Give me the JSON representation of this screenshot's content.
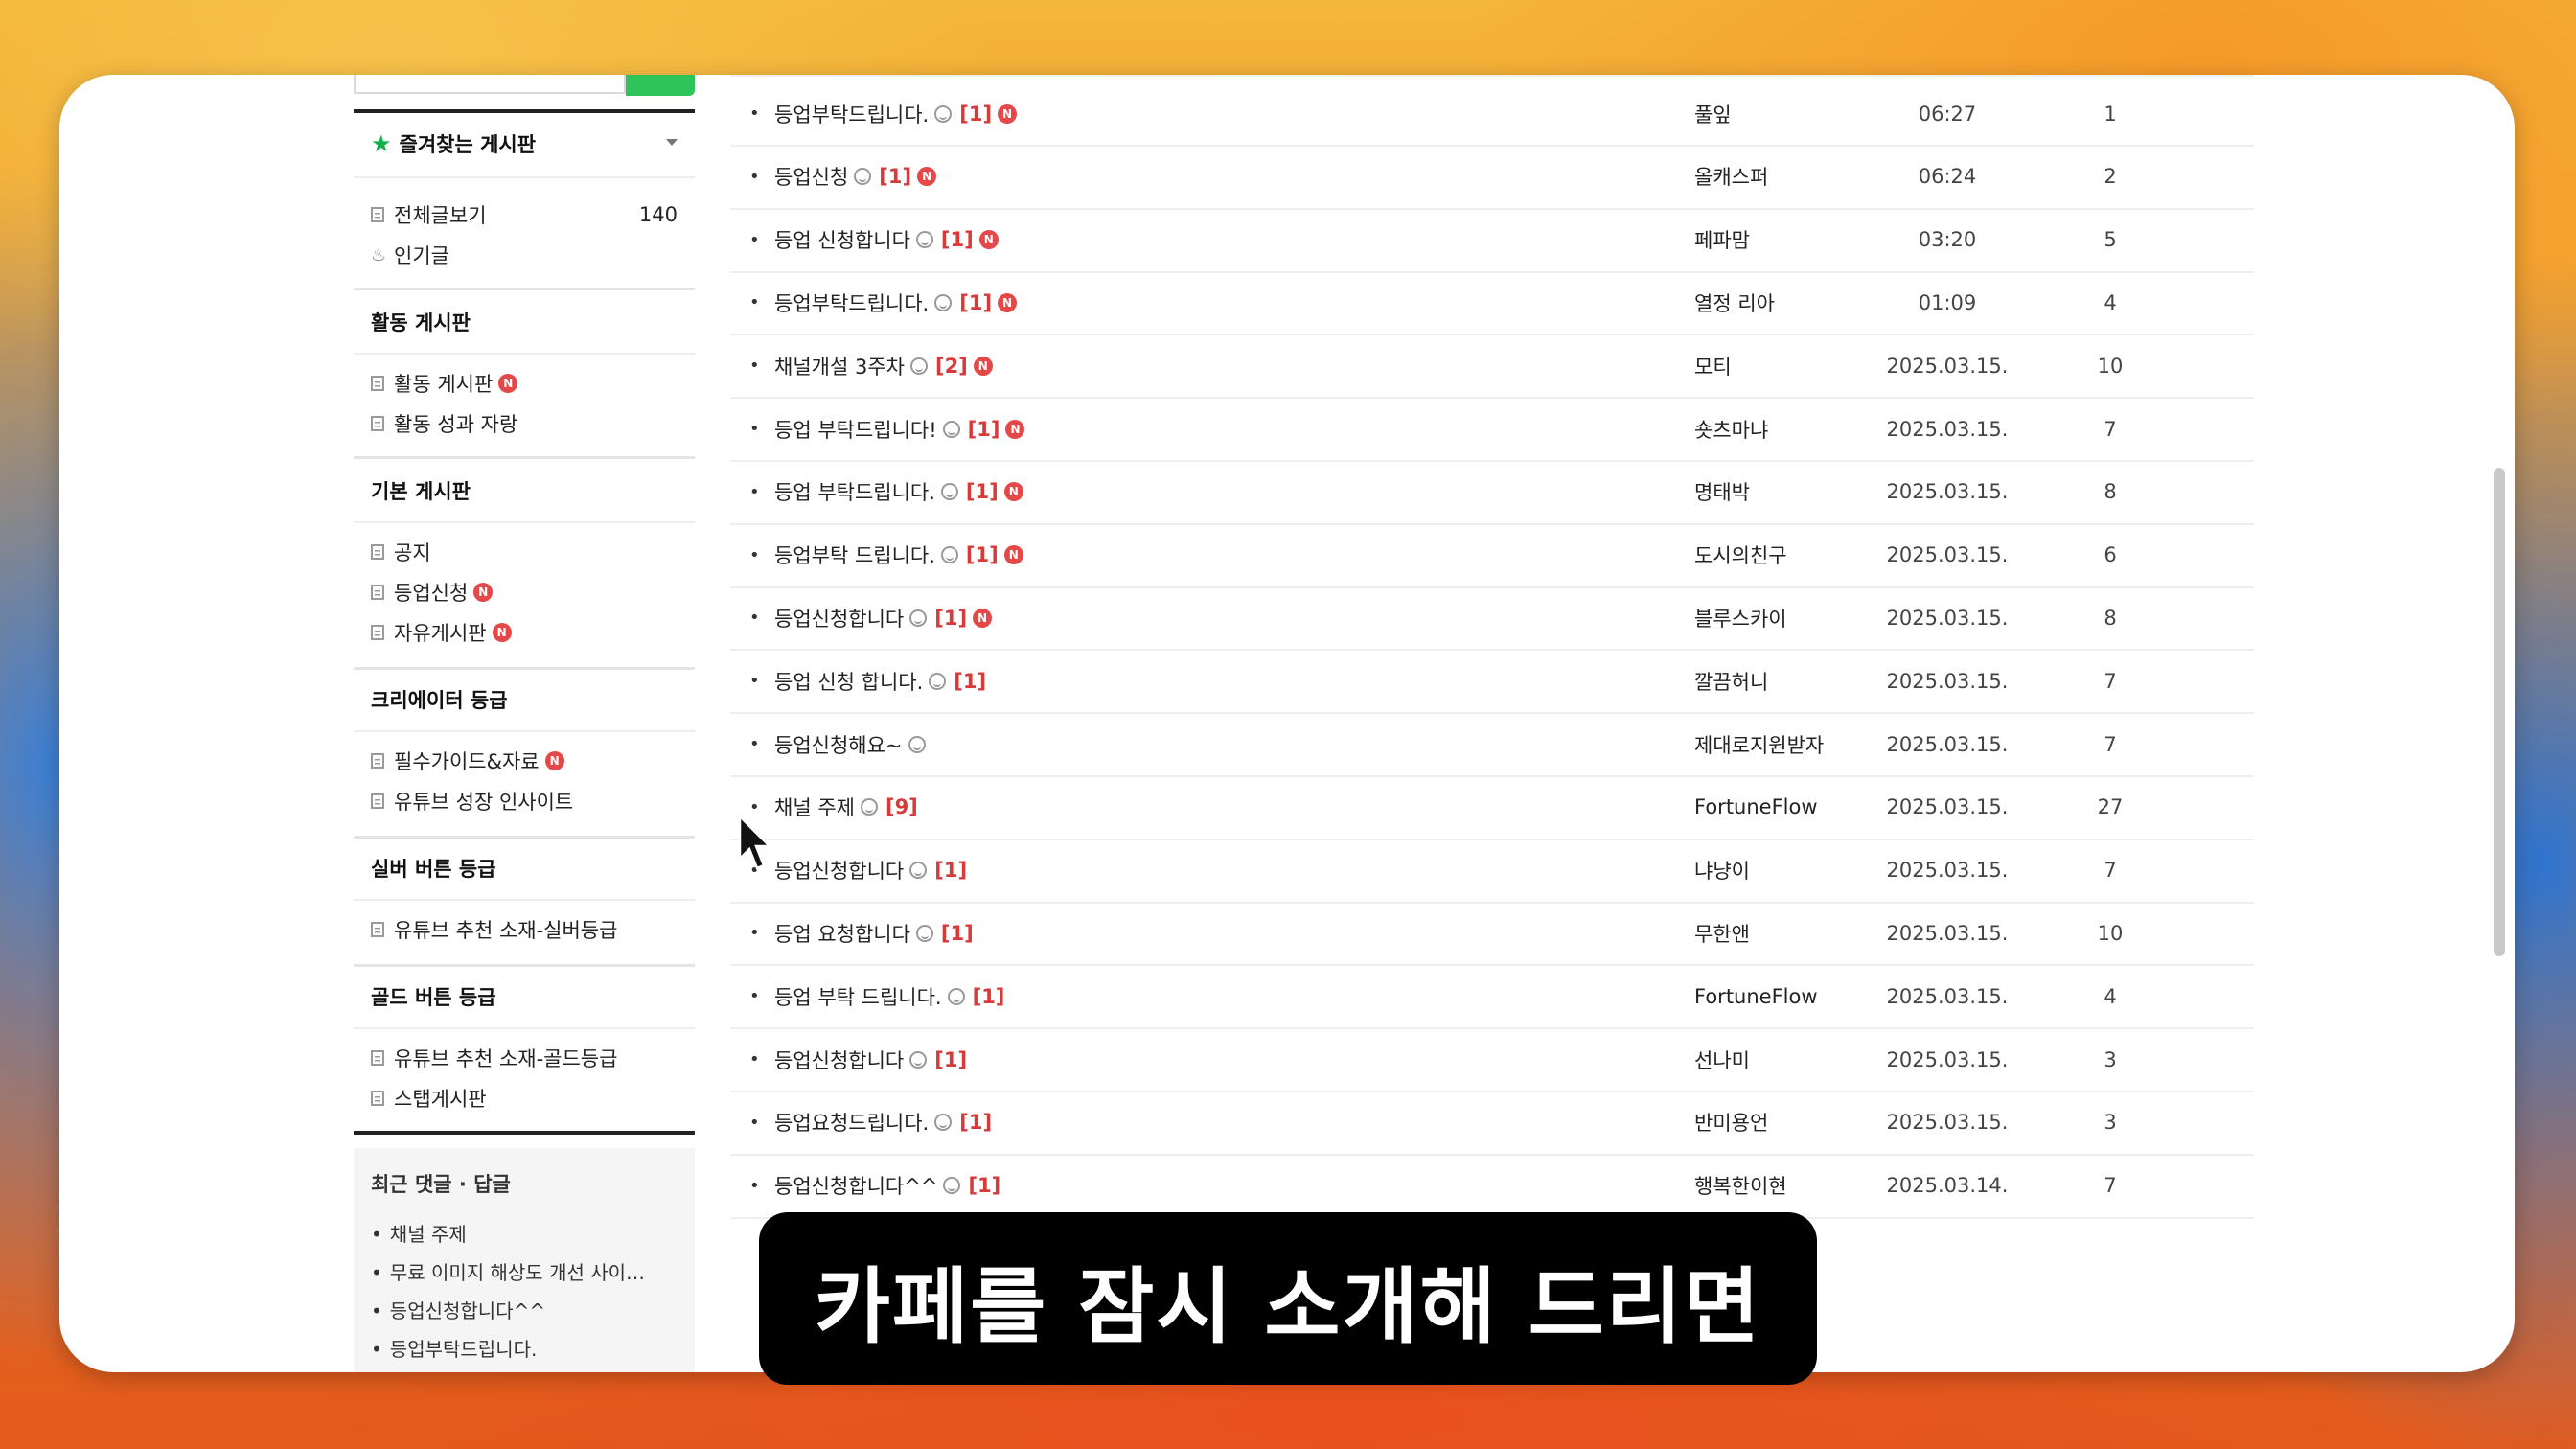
{
  "sidebar": {
    "favorites_label": "즐겨찾는 게시판",
    "all_posts": {
      "label": "전체글보기",
      "count": "140"
    },
    "popular_label": "인기글",
    "sections": [
      {
        "title": "활동 게시판",
        "items": [
          {
            "label": "활동 게시판",
            "new": true
          },
          {
            "label": "활동 성과 자랑",
            "new": false
          }
        ]
      },
      {
        "title": "기본 게시판",
        "items": [
          {
            "label": "공지",
            "new": false
          },
          {
            "label": "등업신청",
            "new": true
          },
          {
            "label": "자유게시판",
            "new": true
          }
        ]
      },
      {
        "title": "크리에이터 등급",
        "items": [
          {
            "label": "필수가이드&자료",
            "new": true
          },
          {
            "label": "유튜브 성장 인사이트",
            "new": false
          }
        ]
      },
      {
        "title": "실버 버튼 등급",
        "items": [
          {
            "label": "유튜브 추천 소재-실버등급",
            "new": false
          }
        ]
      },
      {
        "title": "골드 버튼 등급",
        "items": [
          {
            "label": "유튜브 추천 소재-골드등급",
            "new": false
          },
          {
            "label": "스탭게시판",
            "new": false
          }
        ]
      }
    ],
    "recent": {
      "title": "최근 댓글 · 답글",
      "items": [
        "채널 주제",
        "무료 이미지 해상도 개선 사이…",
        "등업신청합니다^^",
        "등업부탁드립니다."
      ]
    },
    "badge_new": "N"
  },
  "posts": [
    {
      "title": "등업부탁드립니다.",
      "comments": "[1]",
      "new": true,
      "author": "풀잎",
      "date": "06:27",
      "views": "1"
    },
    {
      "title": "등업신청",
      "comments": "[1]",
      "new": true,
      "author": "올캐스퍼",
      "date": "06:24",
      "views": "2"
    },
    {
      "title": "등업 신청합니다",
      "comments": "[1]",
      "new": true,
      "author": "페파맘",
      "date": "03:20",
      "views": "5"
    },
    {
      "title": "등업부탁드립니다.",
      "comments": "[1]",
      "new": true,
      "author": "열정 리아",
      "date": "01:09",
      "views": "4"
    },
    {
      "title": "채널개설 3주차",
      "comments": "[2]",
      "new": true,
      "author": "모티",
      "date": "2025.03.15.",
      "views": "10"
    },
    {
      "title": "등업 부탁드립니다!",
      "comments": "[1]",
      "new": true,
      "author": "숏츠마냐",
      "date": "2025.03.15.",
      "views": "7"
    },
    {
      "title": "등업 부탁드립니다.",
      "comments": "[1]",
      "new": true,
      "author": "명태박",
      "date": "2025.03.15.",
      "views": "8"
    },
    {
      "title": "등업부탁 드립니다.",
      "comments": "[1]",
      "new": true,
      "author": "도시의친구",
      "date": "2025.03.15.",
      "views": "6"
    },
    {
      "title": "등업신청합니다",
      "comments": "[1]",
      "new": true,
      "author": "블루스카이",
      "date": "2025.03.15.",
      "views": "8"
    },
    {
      "title": "등업 신청 합니다.",
      "comments": "[1]",
      "new": false,
      "author": "깔끔허니",
      "date": "2025.03.15.",
      "views": "7"
    },
    {
      "title": "등업신청해요~",
      "comments": "",
      "new": false,
      "author": "제대로지원받자",
      "date": "2025.03.15.",
      "views": "7"
    },
    {
      "title": "채널 주제",
      "comments": "[9]",
      "new": false,
      "author": "FortuneFlow",
      "date": "2025.03.15.",
      "views": "27"
    },
    {
      "title": "등업신청합니다",
      "comments": "[1]",
      "new": false,
      "author": "냐냥이",
      "date": "2025.03.15.",
      "views": "7"
    },
    {
      "title": "등업 요청합니다",
      "comments": "[1]",
      "new": false,
      "author": "무한앤",
      "date": "2025.03.15.",
      "views": "10"
    },
    {
      "title": "등업 부탁 드립니다.",
      "comments": "[1]",
      "new": false,
      "author": "FortuneFlow",
      "date": "2025.03.15.",
      "views": "4"
    },
    {
      "title": "등업신청합니다",
      "comments": "[1]",
      "new": false,
      "author": "선나미",
      "date": "2025.03.15.",
      "views": "3"
    },
    {
      "title": "등업요청드립니다.",
      "comments": "[1]",
      "new": false,
      "author": "반미용언",
      "date": "2025.03.15.",
      "views": "3"
    },
    {
      "title": "등업신청합니다^^",
      "comments": "[1]",
      "new": false,
      "author": "행복한이현",
      "date": "2025.03.14.",
      "views": "7"
    }
  ],
  "subtitle": "카페를 잠시 소개해 드리면"
}
